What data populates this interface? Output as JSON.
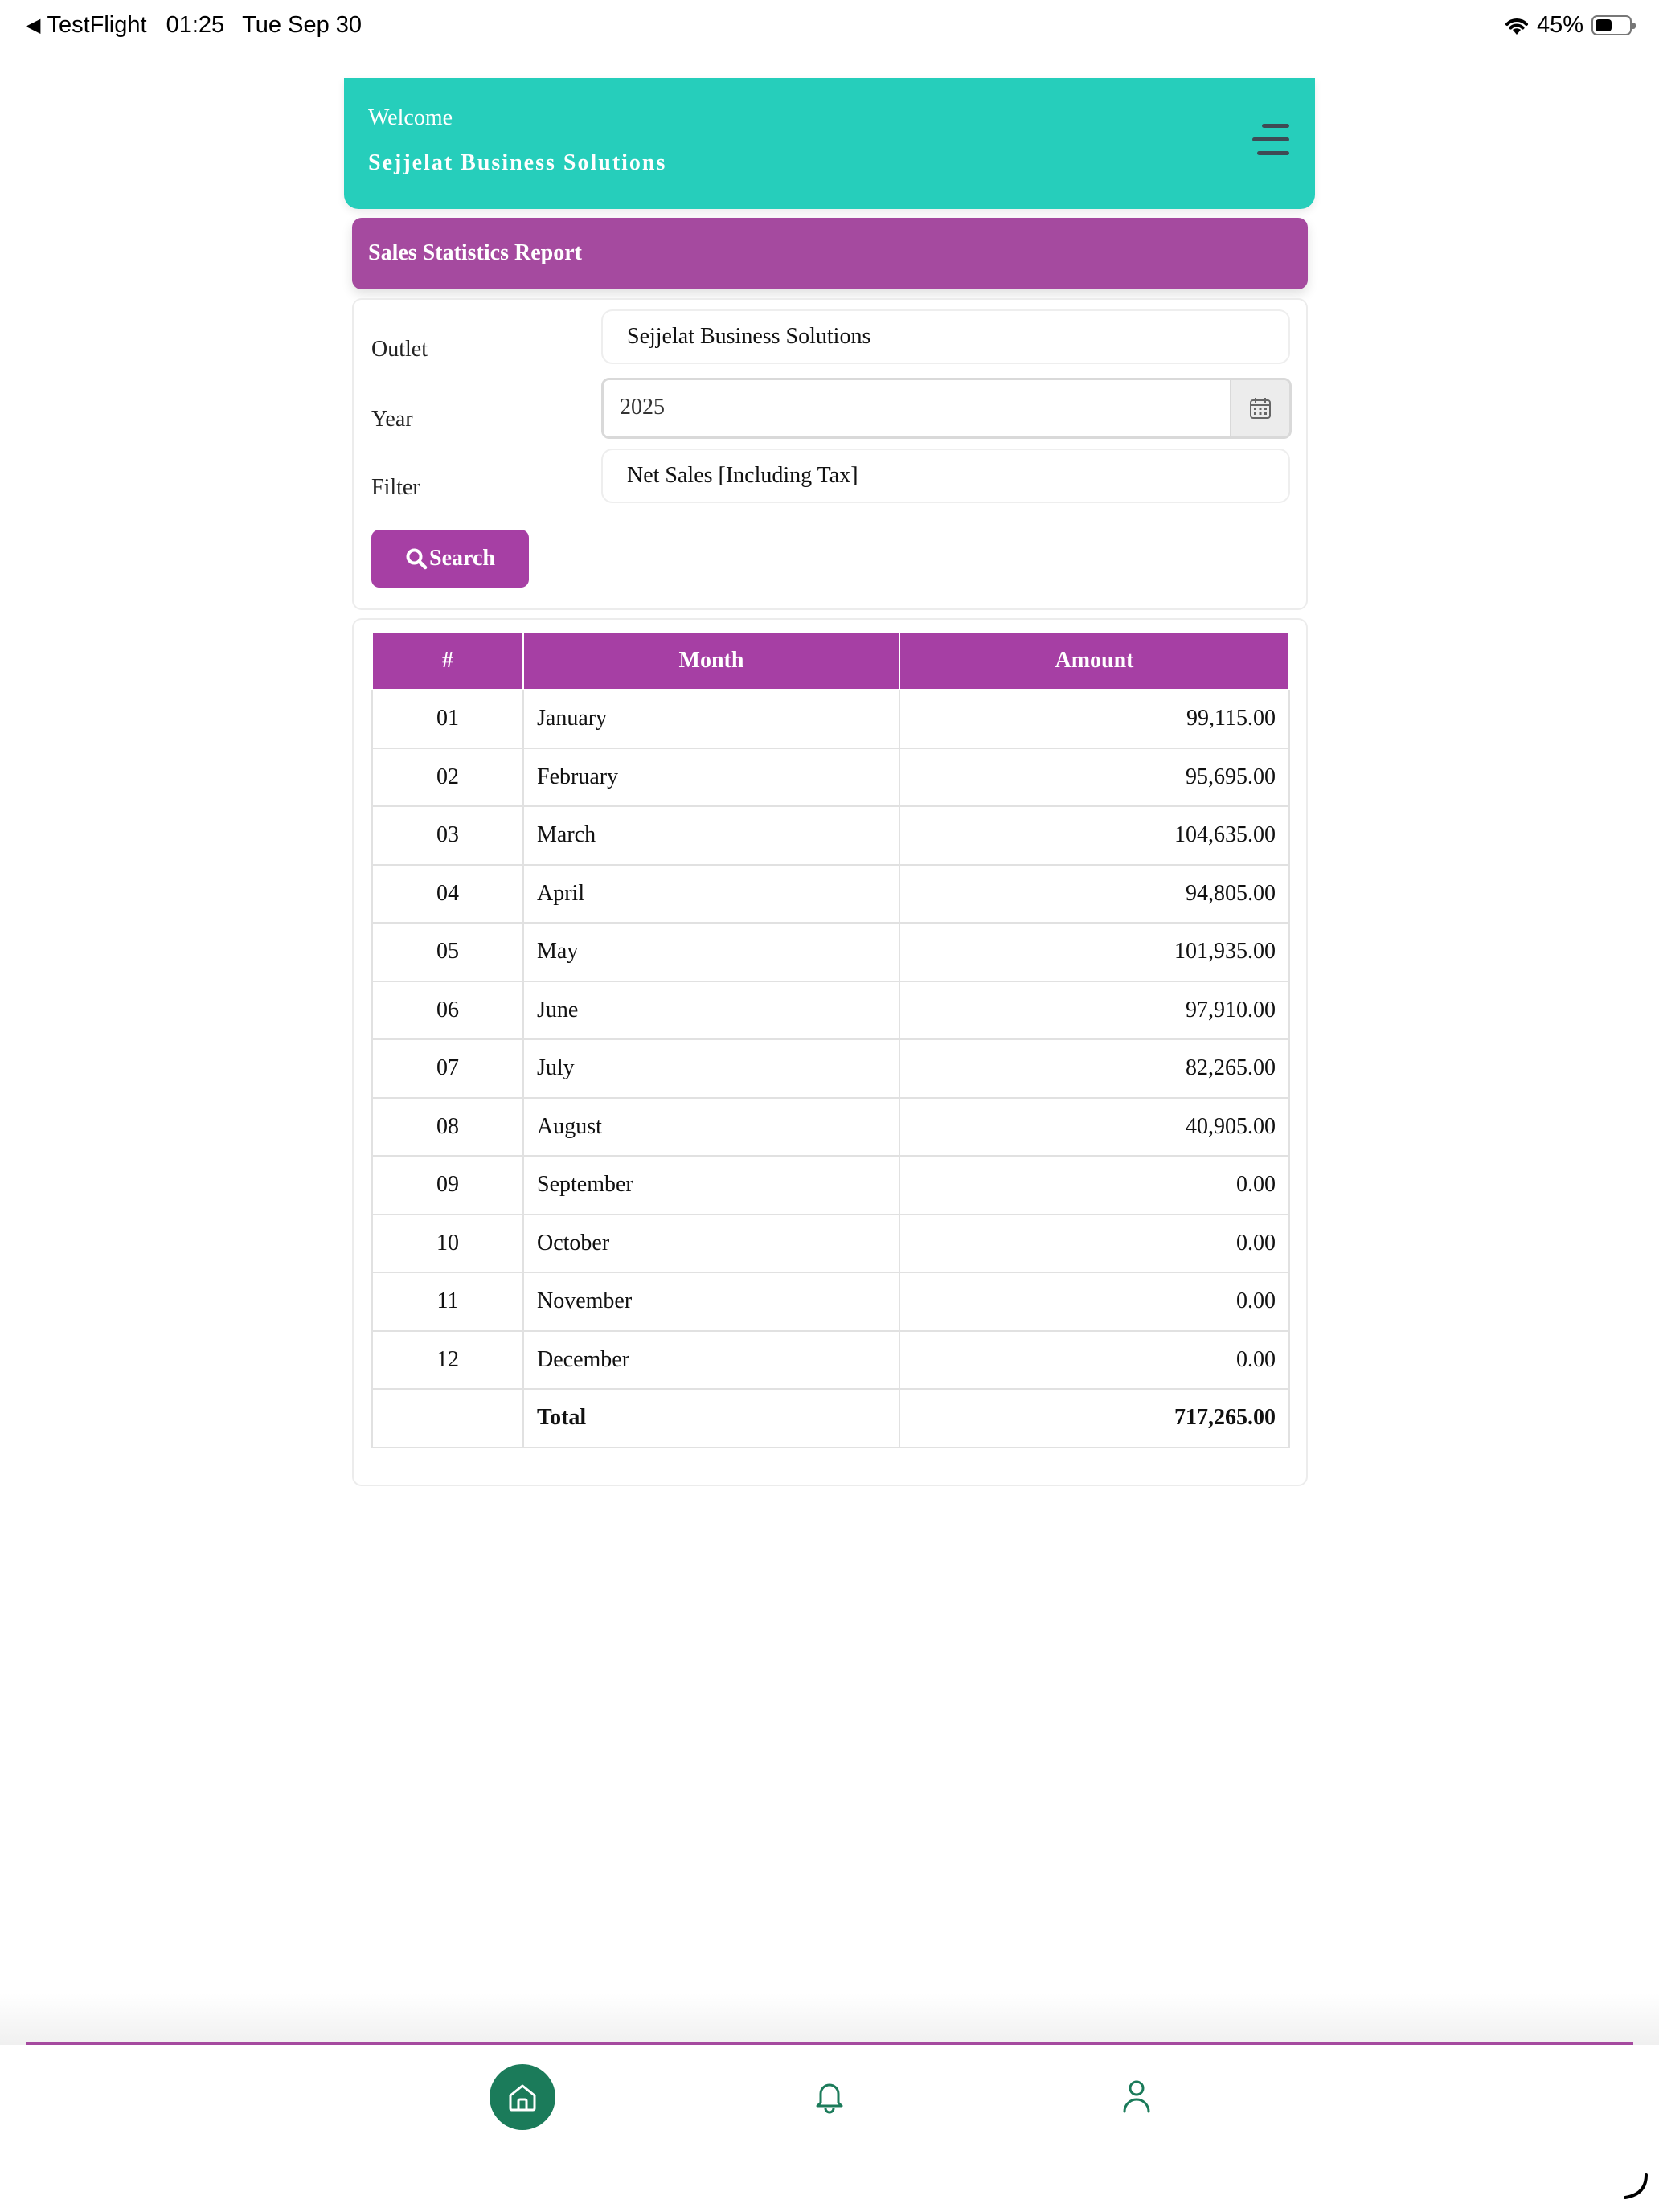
{
  "status_bar": {
    "back_app": "TestFlight",
    "time": "01:25",
    "date": "Tue Sep 30",
    "battery_percent": "45%",
    "battery_level": 0.45
  },
  "header": {
    "welcome": "Welcome",
    "company": "Sejjelat Business Solutions",
    "menu_icon": "hamburger-icon"
  },
  "report": {
    "title": "Sales Statistics Report"
  },
  "filters": {
    "outlet_label": "Outlet",
    "outlet_value": "Sejjelat Business Solutions",
    "year_label": "Year",
    "year_value": "2025",
    "year_icon": "calendar-icon",
    "filter_label": "Filter",
    "filter_value": "Net Sales [Including Tax]",
    "search_label": "Search",
    "search_icon": "search-icon"
  },
  "table": {
    "headers": [
      "#",
      "Month",
      "Amount"
    ],
    "rows": [
      {
        "num": "01",
        "month": "January",
        "amount": "99,115.00"
      },
      {
        "num": "02",
        "month": "February",
        "amount": "95,695.00"
      },
      {
        "num": "03",
        "month": "March",
        "amount": "104,635.00"
      },
      {
        "num": "04",
        "month": "April",
        "amount": "94,805.00"
      },
      {
        "num": "05",
        "month": "May",
        "amount": "101,935.00"
      },
      {
        "num": "06",
        "month": "June",
        "amount": "97,910.00"
      },
      {
        "num": "07",
        "month": "July",
        "amount": "82,265.00"
      },
      {
        "num": "08",
        "month": "August",
        "amount": "40,905.00"
      },
      {
        "num": "09",
        "month": "September",
        "amount": "0.00"
      },
      {
        "num": "10",
        "month": "October",
        "amount": "0.00"
      },
      {
        "num": "11",
        "month": "November",
        "amount": "0.00"
      },
      {
        "num": "12",
        "month": "December",
        "amount": "0.00"
      }
    ],
    "total_label": "Total",
    "total_amount": "717,265.00"
  },
  "bottom_nav": {
    "items": [
      {
        "icon": "home-icon",
        "active": true
      },
      {
        "icon": "bell-icon",
        "active": false
      },
      {
        "icon": "user-icon",
        "active": false
      }
    ]
  },
  "colors": {
    "header_teal": "#26cebb",
    "report_purple": "#a54a9f",
    "table_header_purple": "#a63fa4",
    "nav_green": "#1b7b5a"
  }
}
